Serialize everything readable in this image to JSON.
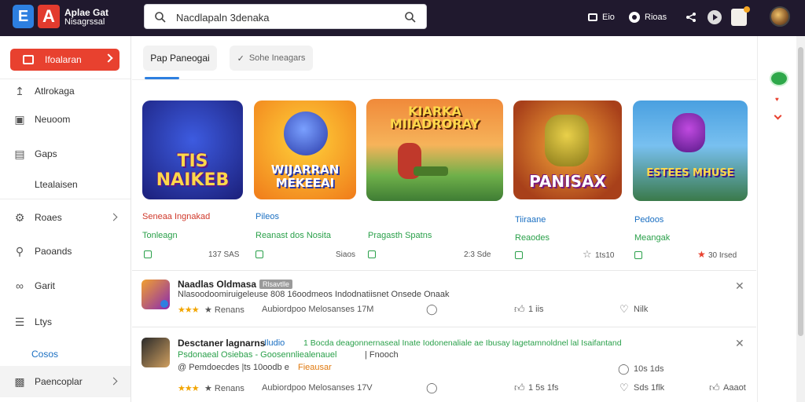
{
  "brand": {
    "logo_e": "E",
    "logo_a": "A",
    "line1": "Aplae Gat",
    "line2": "Nisagrssal"
  },
  "search": {
    "value": "Nacdlapaln 3denaka"
  },
  "topbar": {
    "item1": "Eio",
    "item2": "Rioas"
  },
  "sidebar": {
    "active": "Ifoalaran",
    "items": [
      {
        "label": "Atlrokaga",
        "icon": "upload-icon"
      },
      {
        "label": "Neuoom",
        "icon": "document-icon"
      },
      {
        "label": "Gaps",
        "icon": "list-icon"
      },
      {
        "label": "Ltealaisen",
        "icon": ""
      },
      {
        "label": "Roaes",
        "icon": "settings-icon"
      },
      {
        "label": "Paoands",
        "icon": "person-icon"
      },
      {
        "label": "Garit",
        "icon": "link-icon"
      },
      {
        "label": "Ltys",
        "icon": "menu-icon"
      },
      {
        "label": "Cosos",
        "icon": ""
      },
      {
        "label": "Paencoplar",
        "icon": "bookmark-icon"
      }
    ]
  },
  "tabs": {
    "tab1": "Pap Paneogai",
    "tab2": "Sohe Ineagars"
  },
  "cards": [
    {
      "art": "TIS NAIKEB",
      "title": "Seneaa Ingnakad",
      "sub": "Tonleagn",
      "meta": "137 SAS",
      "title_color": "#d0392b",
      "sub_color": "#2aa04a"
    },
    {
      "art": "WIJARRAN MEKEEAI",
      "title": "Pileos",
      "sub": "Reanast dos Nosita",
      "meta": "Siaos",
      "title_color": "#1a6fc2",
      "sub_color": "#2aa04a"
    },
    {
      "art": "KIARKA MIIADRORAY",
      "title": "",
      "sub": "Pragasth Spatns",
      "meta": "2:3 Sde",
      "title_color": "#2aa04a",
      "sub_color": "#2aa04a"
    },
    {
      "art": "PANISAX",
      "title": "Tiiraane",
      "sub": "Reaodes",
      "meta": "1ts10",
      "title_color": "#1a6fc2",
      "sub_color": "#2aa04a"
    },
    {
      "art": "ESTEES MHUSE",
      "title": "Pedoos",
      "sub": "Meangak",
      "meta": "30 Irsed",
      "title_color": "#1a6fc2",
      "sub_color": "#2aa04a"
    }
  ],
  "rows": [
    {
      "title": "Naadlas Oldmasa",
      "badge": "Rlsavtlle",
      "desc": "Nlasoodoomiruigeleuse 808 16oodmeos Indodnatiisnet Onsede Onaak",
      "rating_label": "Renans",
      "stat": "Aubiordpoo Melosanses 17M",
      "likes": "1 iis",
      "count": "Nilk"
    },
    {
      "title": "Desctaner lagnarns",
      "blue_link": "Iludio",
      "desc": "1 Bocda deagonnernaseal Inate Iodonenaliale ae Ibusay lagetamnoldnel lal Isaifantand",
      "green_line": "Psdonaeal Osiebas - Goosennliealenauel",
      "green_tail": "Fnooch",
      "orange": "@ Pemdoecdes  |ts 10oodb e",
      "orange_badge": "Fieausar",
      "rating_label": "Renans",
      "stat": "Aubiordpoo Melosanses 17V",
      "likes": "1 5s 1fs",
      "count": "Sds 1flk",
      "info": "10s 1ds",
      "extra": "Aaaot"
    }
  ]
}
